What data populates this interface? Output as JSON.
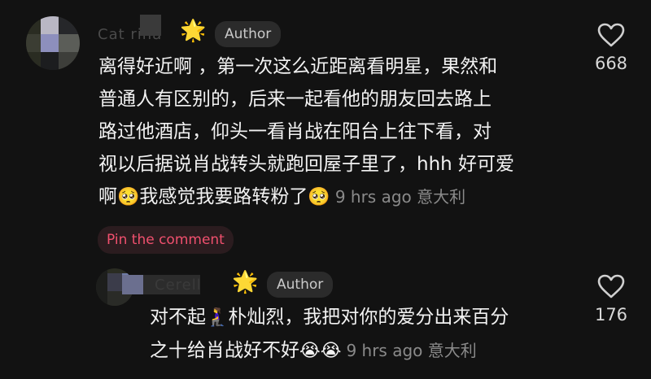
{
  "comments": [
    {
      "username": "Cat  rina",
      "badge": "Author",
      "lines": [
        "离得好近啊 ，第一次这么近距离看明星，果然和",
        "普通人有区别的，后来一起看他的朋友回去路上",
        "路过他酒店，仰头一看肖战在阳台上往下看，对",
        "视以后据说肖战转头就跑回屋子里了，hhh 好可爱"
      ],
      "last_line_text_a": "啊",
      "last_line_text_b": "我感觉我要路转粉了",
      "meta": "9 hrs ago 意大利",
      "pin_label": "Pin the comment",
      "like_count": "668"
    },
    {
      "username": "Cerell",
      "badge": "Author",
      "line1_a": "对不起",
      "line1_b": "朴灿烈，我把对你的爱分出来百分",
      "line2": "之十给肖战好不好",
      "meta": "9 hrs ago 意大利",
      "like_count": "176"
    }
  ],
  "icons": {
    "star": "🌟",
    "shy_face": "🥺",
    "person_kneeling": "🧎‍♀️",
    "crying_face": "😭"
  },
  "colors": {
    "background": "#121212",
    "pin_text": "#f0506e",
    "meta": "#8a8a8a"
  }
}
